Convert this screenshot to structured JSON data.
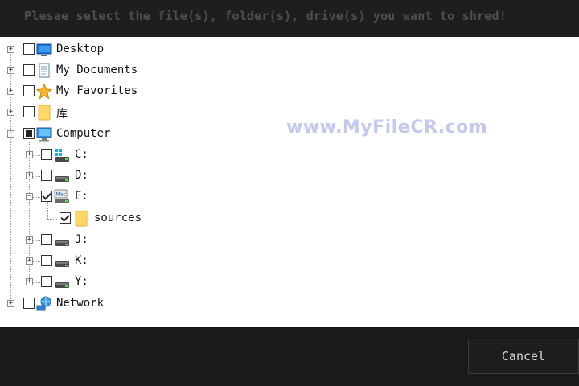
{
  "header": {
    "title": "Plesae select the file(s), folder(s), drive(s) you want to shred!"
  },
  "tree": {
    "items": [
      {
        "label": "Desktop",
        "icon": "desktop-icon",
        "state": "unchecked"
      },
      {
        "label": "My Documents",
        "icon": "document-icon",
        "state": "unchecked"
      },
      {
        "label": "My Favorites",
        "icon": "star-icon",
        "state": "unchecked"
      },
      {
        "label": "库",
        "icon": "folder-icon",
        "state": "unchecked"
      },
      {
        "label": "Computer",
        "icon": "computer-icon",
        "state": "partial"
      },
      {
        "label": "C:",
        "icon": "system-drive-icon",
        "state": "unchecked"
      },
      {
        "label": "D:",
        "icon": "drive-icon",
        "state": "unchecked"
      },
      {
        "label": "E:",
        "icon": "removable-drive-icon",
        "state": "checked"
      },
      {
        "label": "sources",
        "icon": "folder-icon",
        "state": "checked"
      },
      {
        "label": "J:",
        "icon": "drive-icon",
        "state": "unchecked"
      },
      {
        "label": "K:",
        "icon": "drive-icon",
        "state": "unchecked"
      },
      {
        "label": "Y:",
        "icon": "drive-icon",
        "state": "unchecked"
      },
      {
        "label": "Network",
        "icon": "network-icon",
        "state": "unchecked"
      }
    ]
  },
  "watermark": "www.MyFileCR.com",
  "footer": {
    "cancel_label": "Cancel"
  },
  "colors": {
    "header_bg": "#1e1e1e",
    "tree_bg": "#ffffff",
    "title_text": "#4f4f4f",
    "button_text": "#d8d8d8"
  }
}
